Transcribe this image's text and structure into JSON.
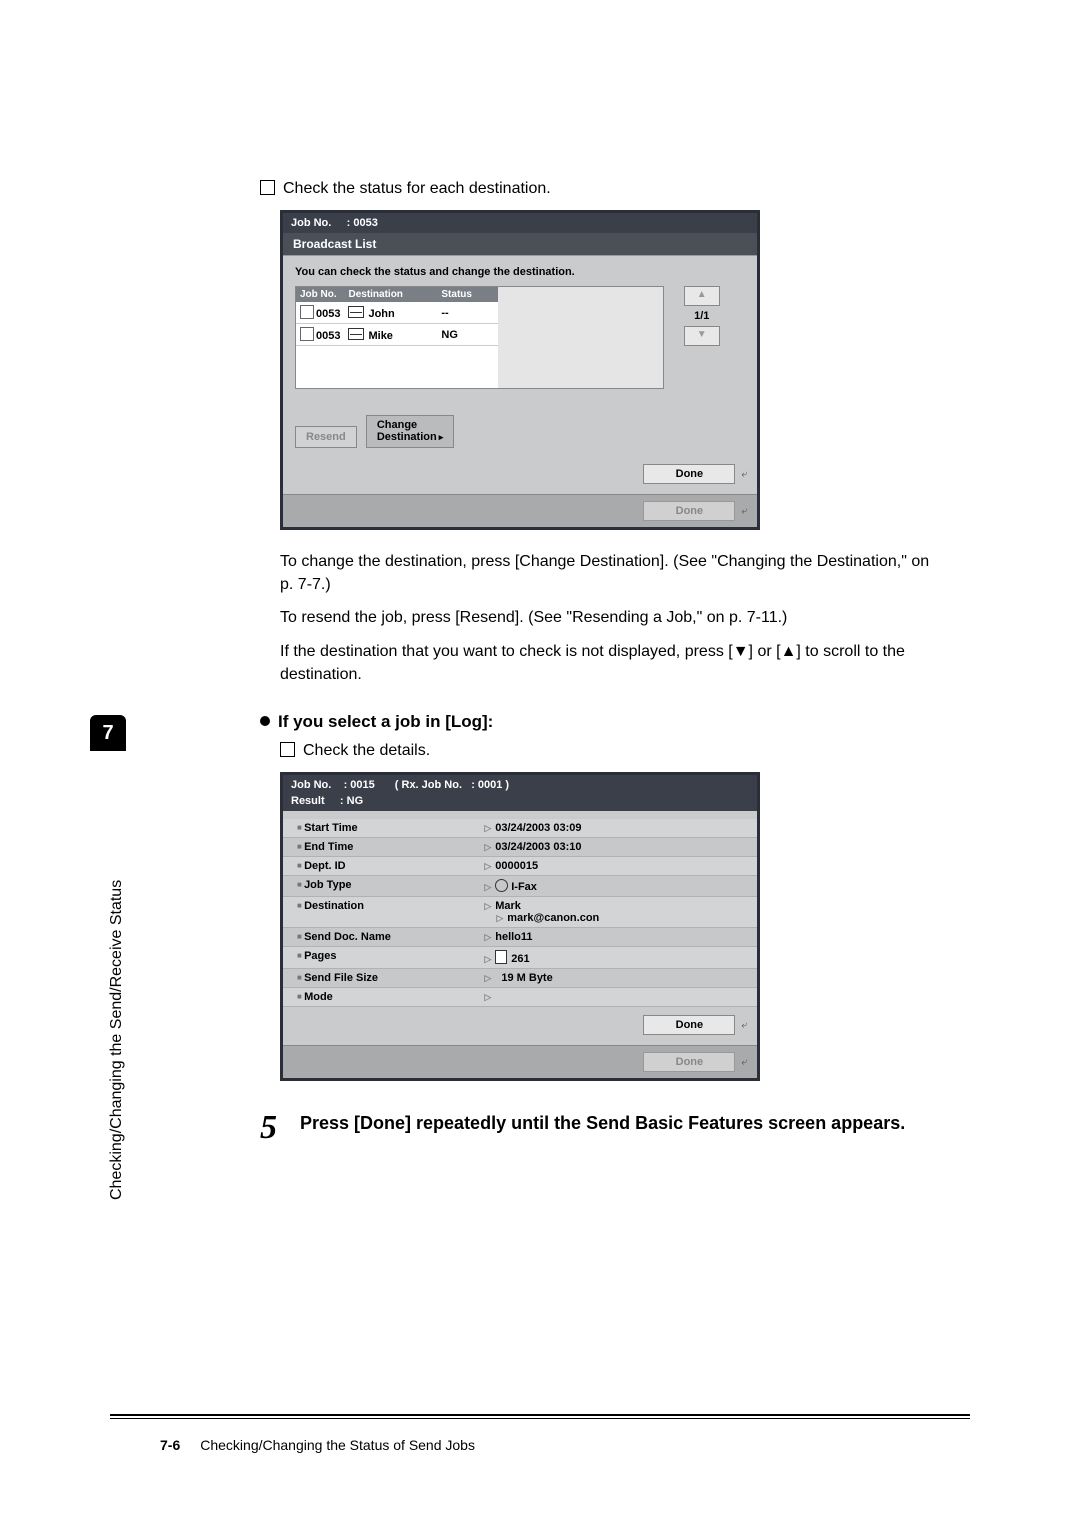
{
  "chapter_number": "7",
  "sidebar_text": "Checking/Changing the Send/Receive Status",
  "intro_check": "Check the status for each destination.",
  "screenshot1": {
    "job_no_label": "Job No.",
    "job_no_value": ": 0053",
    "title": "Broadcast List",
    "help": "You can check the status and change the destination.",
    "headers": {
      "jobno": "Job No.",
      "dest": "Destination",
      "status": "Status"
    },
    "rows": [
      {
        "job": "0053",
        "name": "John",
        "status": "--"
      },
      {
        "job": "0053",
        "name": "Mike",
        "status": "NG"
      }
    ],
    "pager": "1/1",
    "btn_resend": "Resend",
    "btn_change": "Change\nDestination",
    "done": "Done"
  },
  "para_change": "To change the destination, press [Change Destination]. (See \"Changing the Destination,\" on p. 7-7.)",
  "para_resend": "To resend the job, press [Resend]. (See \"Resending a Job,\" on p. 7-11.)",
  "para_scroll_pre": "If the destination that you want to check is not displayed, press [",
  "para_scroll_mid": "] or [",
  "para_scroll_post": "] to scroll to the destination.",
  "log_heading": "If you select a job in [Log]:",
  "log_check": "Check the details.",
  "screenshot2": {
    "titlebar": {
      "jobno_l": "Job No.",
      "jobno_v": ": 0015",
      "rxjob_l": "( Rx. Job No.",
      "rxjob_v": ": 0001 )",
      "result_l": "Result",
      "result_v": ": NG"
    },
    "rows": [
      {
        "label": "Start Time",
        "value": "03/24/2003 03:09"
      },
      {
        "label": "End Time",
        "value": "03/24/2003 03:10"
      },
      {
        "label": "Dept. ID",
        "value": "0000015"
      },
      {
        "label": "Job Type",
        "value": "I-Fax",
        "icon": "globe"
      },
      {
        "label": "Destination",
        "value": "Mark",
        "value2": "mark@canon.con"
      },
      {
        "label": "Send Doc. Name",
        "value": "hello11"
      },
      {
        "label": "Pages",
        "value": "261",
        "icon": "doc"
      },
      {
        "label": "Send File Size",
        "value": "19  M Byte"
      },
      {
        "label": "Mode",
        "value": ""
      }
    ],
    "done": "Done"
  },
  "step5_num": "5",
  "step5_text": "Press [Done] repeatedly until the Send Basic Features screen appears.",
  "footer_page": "7-6",
  "footer_text": "Checking/Changing the Status of Send Jobs"
}
